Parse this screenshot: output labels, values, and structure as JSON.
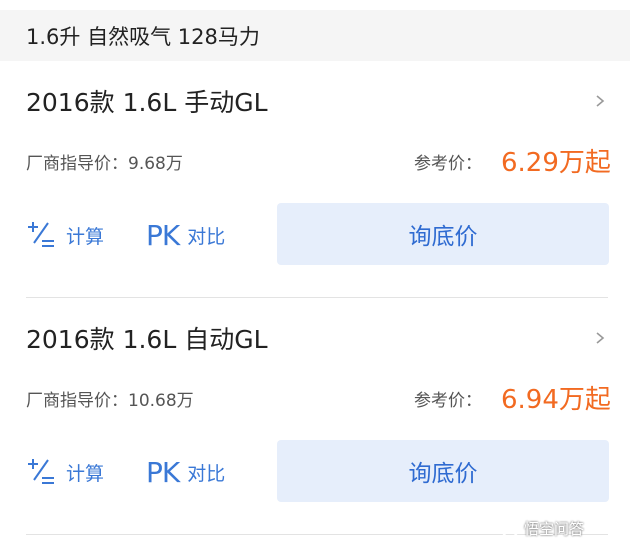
{
  "section": {
    "header": "1.6升 自然吸气 128马力"
  },
  "cards": [
    {
      "model": "2016款 1.6L 手动GL",
      "guide_price": "厂商指导价：9.68万",
      "ref_label": "参考价：",
      "ref_price": "6.29万起",
      "calc_label": "计算",
      "pk_glyph": "PK",
      "pk_label": "对比",
      "ask_button": "询底价"
    },
    {
      "model": "2016款 1.6L 自动GL",
      "guide_price": "厂商指导价：10.68万",
      "ref_label": "参考价：",
      "ref_price": "6.94万起",
      "calc_label": "计算",
      "pk_glyph": "PK",
      "pk_label": "对比",
      "ask_button": "询底价"
    }
  ],
  "watermark": {
    "text": "悟空问答"
  },
  "colors": {
    "accent_blue": "#3a78d6",
    "price_orange": "#f26a21",
    "button_bg": "#e6eefb"
  },
  "icons": [
    "chevron-right-icon",
    "calculator-icon",
    "pk-icon"
  ]
}
